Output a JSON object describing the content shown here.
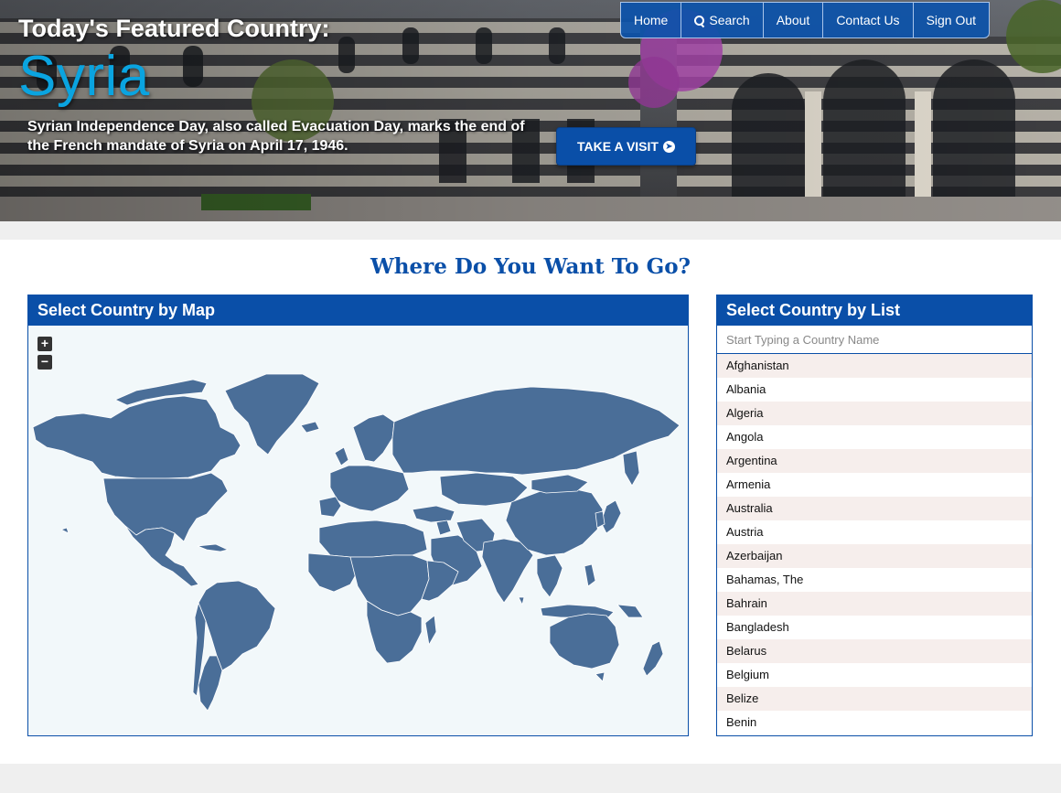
{
  "hero": {
    "title": "Today's Featured Country:",
    "country": "Syria",
    "description": "Syrian Independence Day, also called Evacuation Day, marks the end of the French mandate of Syria on April 17, 1946.",
    "cta_label": "TAKE A VISIT"
  },
  "nav": {
    "items": [
      {
        "label": "Home"
      },
      {
        "label": "Search",
        "icon": "search-icon"
      },
      {
        "label": "About"
      },
      {
        "label": "Contact Us"
      },
      {
        "label": "Sign Out"
      }
    ]
  },
  "main": {
    "heading": "Where Do You Want To Go?"
  },
  "map_panel": {
    "title": "Select Country by Map",
    "zoom_in": "+",
    "zoom_out": "−"
  },
  "list_panel": {
    "title": "Select Country by List",
    "search_placeholder": "Start Typing a Country Name",
    "countries": [
      "Afghanistan",
      "Albania",
      "Algeria",
      "Angola",
      "Argentina",
      "Armenia",
      "Australia",
      "Austria",
      "Azerbaijan",
      "Bahamas, The",
      "Bahrain",
      "Bangladesh",
      "Belarus",
      "Belgium",
      "Belize",
      "Benin"
    ]
  },
  "colors": {
    "brand_blue": "#0a4fa8",
    "country_fill": "#4a6e98",
    "hero_country": "#0aa4e0",
    "list_stripe": "#f6eeec"
  }
}
